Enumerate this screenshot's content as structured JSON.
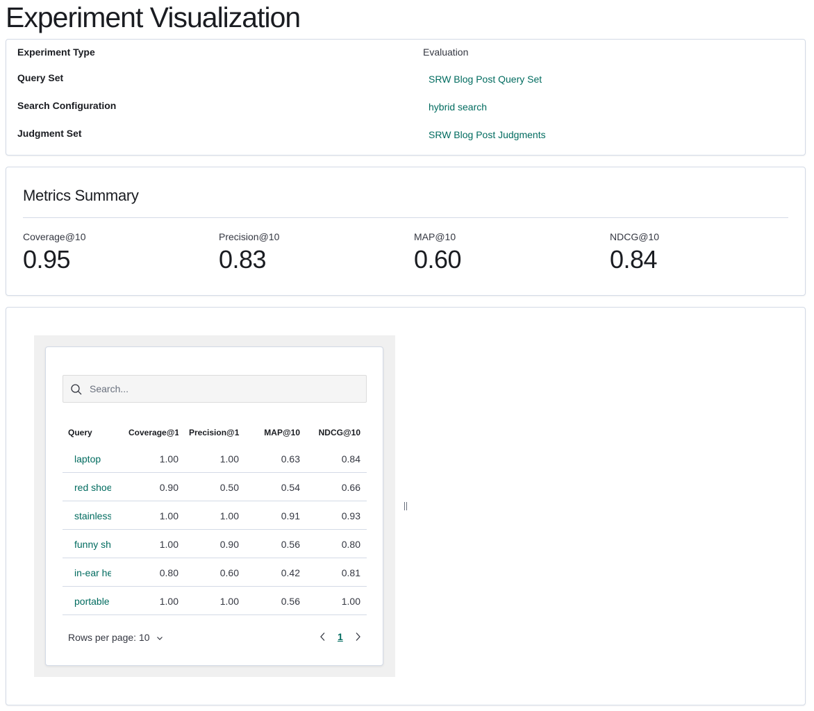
{
  "page": {
    "title": "Experiment Visualization"
  },
  "details": {
    "experiment_type_label": "Experiment Type",
    "experiment_type_value": "Evaluation",
    "query_set_label": "Query Set",
    "query_set_value": "SRW Blog Post Query Set",
    "search_configuration_label": "Search Configuration",
    "search_configuration_value": "hybrid search",
    "judgment_set_label": "Judgment Set",
    "judgment_set_value": "SRW Blog Post Judgments"
  },
  "metrics": {
    "title": "Metrics Summary",
    "items": [
      {
        "label": "Coverage@10",
        "value": "0.95"
      },
      {
        "label": "Precision@10",
        "value": "0.83"
      },
      {
        "label": "MAP@10",
        "value": "0.60"
      },
      {
        "label": "NDCG@10",
        "value": "0.84"
      }
    ]
  },
  "table": {
    "search_placeholder": "Search...",
    "columns": [
      "Query",
      "Coverage@1",
      "Precision@1",
      "MAP@10",
      "NDCG@10"
    ],
    "rows": [
      {
        "query": "laptop",
        "coverage": "1.00",
        "precision": "1.00",
        "map": "0.63",
        "ndcg": "0.84"
      },
      {
        "query": "red shoe",
        "coverage": "0.90",
        "precision": "0.50",
        "map": "0.54",
        "ndcg": "0.66"
      },
      {
        "query": "stainless",
        "coverage": "1.00",
        "precision": "1.00",
        "map": "0.91",
        "ndcg": "0.93"
      },
      {
        "query": "funny sh",
        "coverage": "1.00",
        "precision": "0.90",
        "map": "0.56",
        "ndcg": "0.80"
      },
      {
        "query": "in-ear he",
        "coverage": "0.80",
        "precision": "0.60",
        "map": "0.42",
        "ndcg": "0.81"
      },
      {
        "query": "portable",
        "coverage": "1.00",
        "precision": "1.00",
        "map": "0.56",
        "ndcg": "1.00"
      }
    ],
    "rows_per_page_label": "Rows per page: 10",
    "current_page": "1"
  },
  "colors": {
    "accent": "#006b5f",
    "border": "#d3dae6",
    "text": "#1a1c21"
  },
  "icons": {
    "search": "search-icon",
    "chevron_down": "chevron-down-icon",
    "prev": "chevron-left-icon",
    "next": "chevron-right-icon"
  }
}
